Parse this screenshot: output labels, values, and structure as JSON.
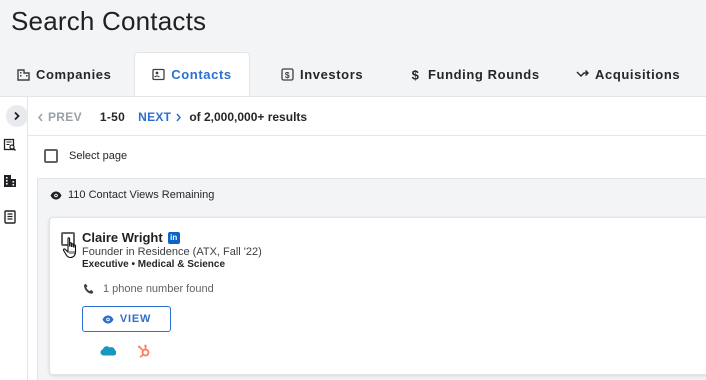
{
  "page": {
    "title": "Search Contacts"
  },
  "tabs": [
    {
      "label": "Companies",
      "icon": "building-icon"
    },
    {
      "label": "Contacts",
      "icon": "contact-card-icon",
      "active": true
    },
    {
      "label": "Investors",
      "icon": "dollar-square-icon"
    },
    {
      "label": "Funding Rounds",
      "icon": "dollar-icon"
    },
    {
      "label": "Acquisitions",
      "icon": "merge-arrow-icon"
    }
  ],
  "rail": {
    "toggle_icon": "chevron-right-icon",
    "icons": [
      "search-list-icon",
      "building-icon",
      "document-icon"
    ]
  },
  "pager": {
    "prev_label": "PREV",
    "range": "1-50",
    "next_label": "NEXT",
    "total": "of 2,000,000+ results"
  },
  "select_page": {
    "label": "Select page"
  },
  "views": {
    "remaining": "110 Contact Views Remaining"
  },
  "contact": {
    "name": "Claire Wright",
    "linkedin_label": "in",
    "title": "Founder in Residence (ATX, Fall '22)",
    "tags": "Executive • Medical & Science",
    "phone": "1 phone number found",
    "view_label": "VIEW",
    "integrations": [
      "salesforce",
      "hubspot"
    ]
  },
  "colors": {
    "accent": "#2d6fcf",
    "linkedin": "#0a66c2",
    "salesforce": "#1798c1",
    "hubspot": "#ff7a59"
  }
}
